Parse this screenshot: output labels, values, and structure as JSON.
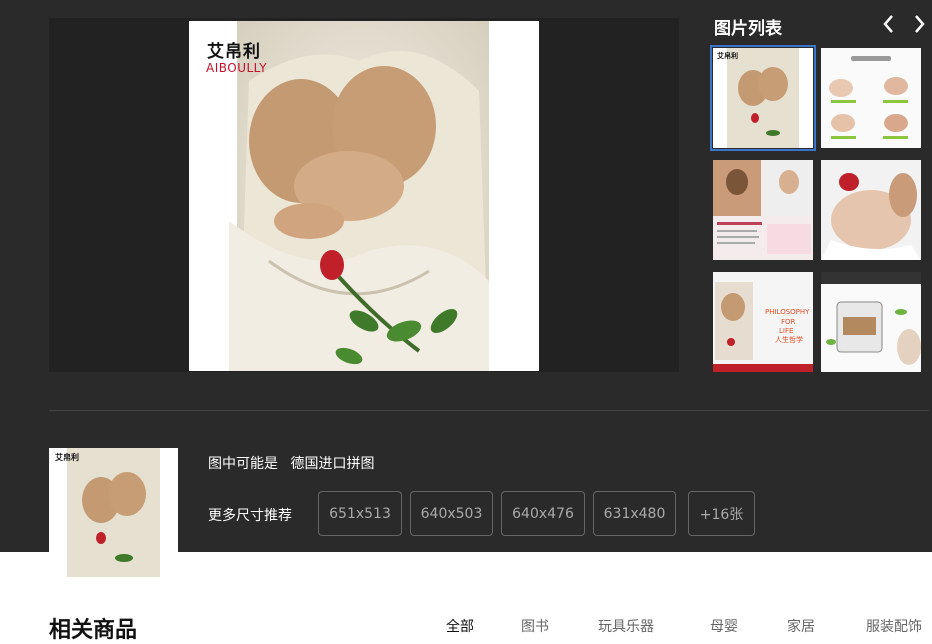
{
  "viewer": {
    "brand_cn": "艾帛利",
    "brand_en": "AIBOULLY"
  },
  "picture_list": {
    "title": "图片列表",
    "prev_icon": "chevron-left-icon",
    "next_icon": "chevron-right-icon",
    "thumb3_text": "PHILOSOPHY FOR LIFE 人生哲学"
  },
  "info": {
    "maybe_label": "图中可能是",
    "maybe_value": "德国进口拼图",
    "more_sizes_label": "更多尺寸推荐",
    "sizes": [
      "651x513",
      "640x503",
      "640x476",
      "631x480",
      "+16张"
    ]
  },
  "related": {
    "title": "相关商品",
    "categories": [
      "全部",
      "图书",
      "玩具乐器",
      "母婴",
      "家居",
      "服装配饰"
    ]
  },
  "colors": {
    "background_dark": "#2b2a2a",
    "selected_outline": "#3b74c8",
    "brand_red": "#c8102e"
  }
}
